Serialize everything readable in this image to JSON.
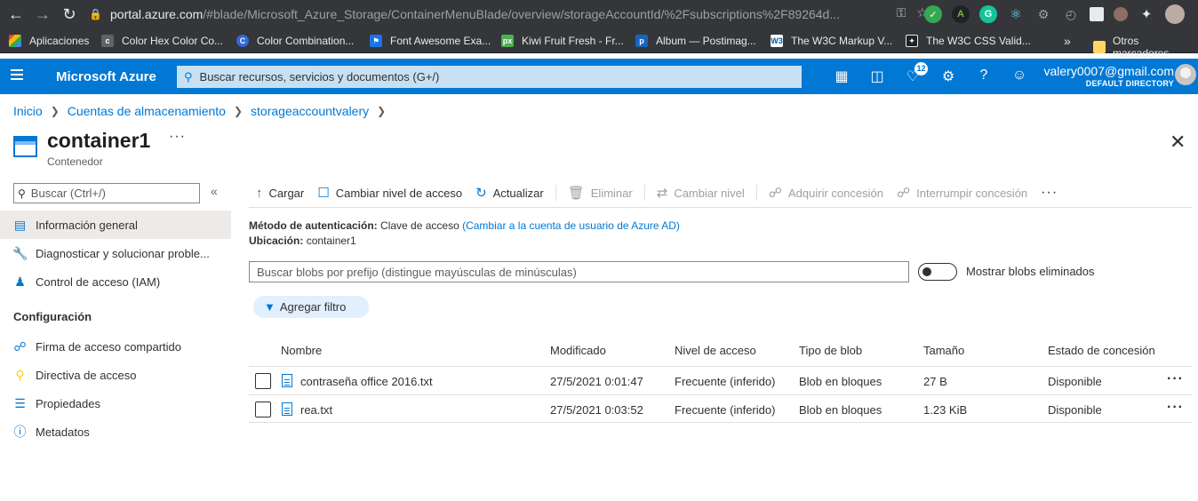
{
  "browser": {
    "url_host": "portal.azure.com",
    "url_rest": "/#blade/Microsoft_Azure_Storage/ContainerMenuBlade/overview/storageAccountId/%2Fsubscriptions%2F89264d...",
    "bookmarks": [
      {
        "label": "Aplicaciones",
        "icon": "apps-icon",
        "color": "#ea4335"
      },
      {
        "label": "Color Hex Color Co...",
        "icon": "colorhex-icon",
        "color": "#5f6368"
      },
      {
        "label": "Color Combination...",
        "icon": "colorcombo-icon",
        "color": "#3367d6"
      },
      {
        "label": "Font Awesome Exa...",
        "icon": "flag-icon",
        "color": "#1a73e8"
      },
      {
        "label": "Kiwi Fruit Fresh - Fr...",
        "icon": "px-icon",
        "color": "#4caf50"
      },
      {
        "label": "Album — Postimag...",
        "icon": "postimage-icon",
        "color": "#1565c0"
      },
      {
        "label": "The W3C Markup V...",
        "icon": "w3c-icon",
        "color": "#005a9c"
      },
      {
        "label": "The W3C CSS Valid...",
        "icon": "w3c-css-icon",
        "color": "#202124"
      }
    ],
    "more": "»",
    "other_bookmarks": "Otros marcadores"
  },
  "azure": {
    "brand": "Microsoft Azure",
    "search_placeholder": "Buscar recursos, servicios y documentos (G+/)",
    "notifications_count": "12",
    "user_email": "valery0007@gmail.com",
    "user_directory": "DEFAULT DIRECTORY"
  },
  "breadcrumb": [
    "Inicio",
    "Cuentas de almacenamiento",
    "storageaccountvalery"
  ],
  "page": {
    "title": "container1",
    "subtitle": "Contenedor",
    "more": "···",
    "close": "✕"
  },
  "nav": {
    "search_placeholder": "Buscar (Ctrl+/)",
    "collapse": "«",
    "items": [
      {
        "label": "Información general",
        "icon": "overview-icon",
        "active": true
      },
      {
        "label": "Diagnosticar y solucionar proble...",
        "icon": "wrench-icon"
      },
      {
        "label": "Control de acceso (IAM)",
        "icon": "people-icon"
      }
    ],
    "section": "Configuración",
    "config_items": [
      {
        "label": "Firma de acceso compartido",
        "icon": "link-icon"
      },
      {
        "label": "Directiva de acceso",
        "icon": "key-icon"
      },
      {
        "label": "Propiedades",
        "icon": "properties-icon"
      },
      {
        "label": "Metadatos",
        "icon": "info-icon"
      }
    ]
  },
  "toolbar": {
    "upload": "Cargar",
    "change_access": "Cambiar nivel de acceso",
    "refresh": "Actualizar",
    "delete": "Eliminar",
    "change_tier": "Cambiar nivel",
    "acquire_lease": "Adquirir concesión",
    "break_lease": "Interrumpir concesión",
    "more": "···"
  },
  "info": {
    "auth_label": "Método de autenticación:",
    "auth_value": "Clave de acceso",
    "auth_link": "(Cambiar a la cuenta de usuario de Azure AD)",
    "location_label": "Ubicación:",
    "location_value": "container1"
  },
  "blob_search_placeholder": "Buscar blobs por prefijo (distingue mayúsculas de minúsculas)",
  "show_deleted_label": "Mostrar blobs eliminados",
  "add_filter": "Agregar filtro",
  "table": {
    "headers": [
      "Nombre",
      "Modificado",
      "Nivel de acceso",
      "Tipo de blob",
      "Tamaño",
      "Estado de concesión"
    ],
    "rows": [
      {
        "name": "contraseña office 2016.txt",
        "modified": "27/5/2021 0:01:47",
        "tier": "Frecuente (inferido)",
        "type": "Blob en bloques",
        "size": "27 B",
        "lease": "Disponible"
      },
      {
        "name": "rea.txt",
        "modified": "27/5/2021 0:03:52",
        "tier": "Frecuente (inferido)",
        "type": "Blob en bloques",
        "size": "1.23 KiB",
        "lease": "Disponible"
      }
    ],
    "row_more": "···"
  }
}
